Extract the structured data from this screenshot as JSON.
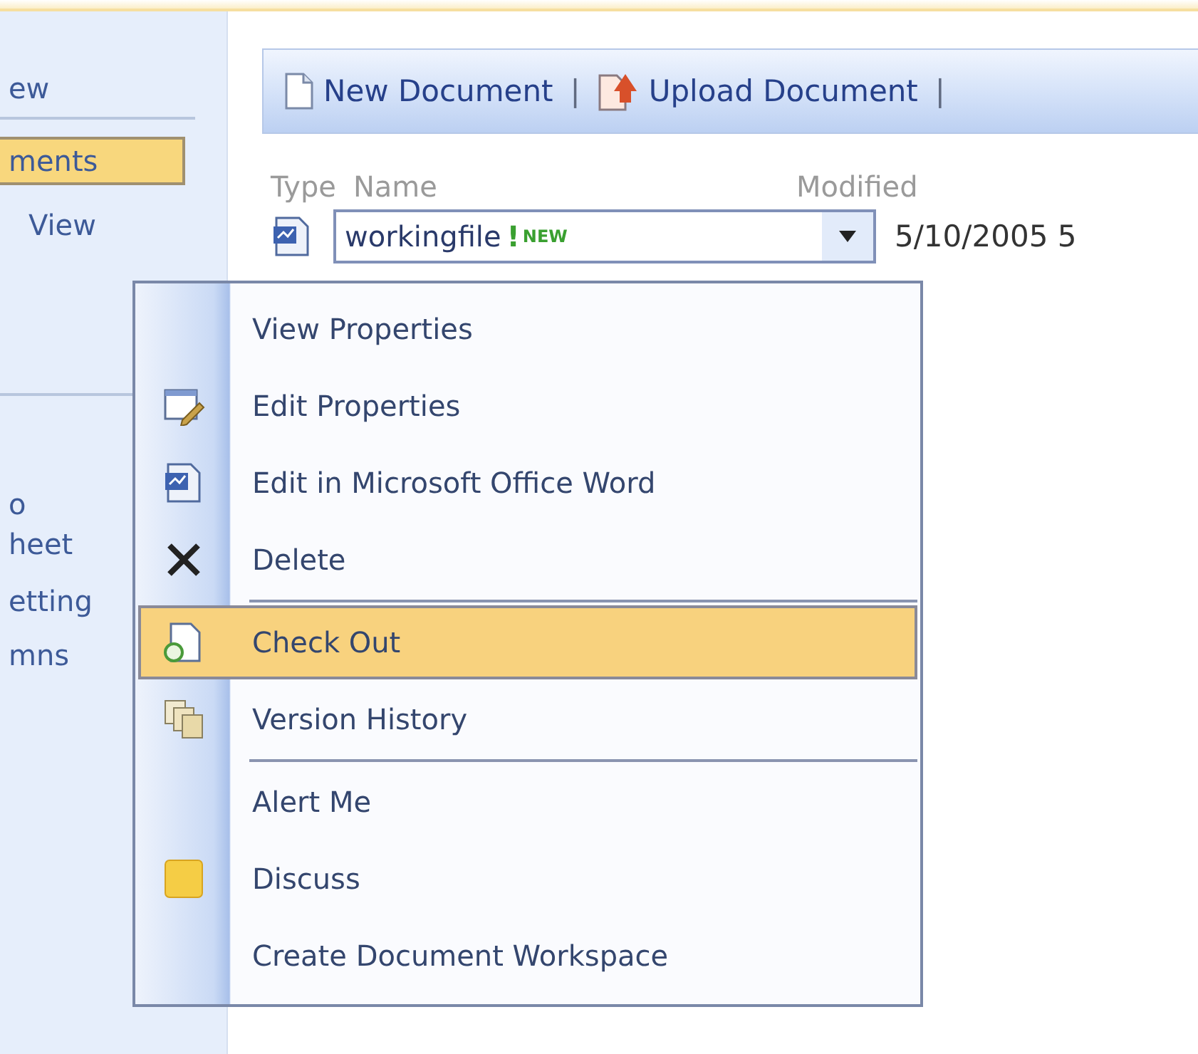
{
  "sidebar": {
    "items": [
      {
        "label": "ew",
        "selected": false
      },
      {
        "label": "ments",
        "selected": true
      },
      {
        "label": "View",
        "selected": false
      },
      {
        "label": "o",
        "selected": false
      },
      {
        "label": "heet",
        "selected": false
      },
      {
        "label": "etting",
        "selected": false
      },
      {
        "label": "mns",
        "selected": false
      }
    ]
  },
  "toolbar": {
    "items": [
      {
        "kind": "new",
        "label": "New Document"
      },
      {
        "kind": "divider",
        "label": "|"
      },
      {
        "kind": "upload",
        "label": "Upload Document"
      },
      {
        "kind": "divider",
        "label": "|"
      }
    ]
  },
  "list": {
    "columns": [
      "Type",
      "Name",
      "Modified"
    ],
    "rows": [
      {
        "name": "workingfile",
        "new_marker": "!",
        "new_badge": "NEW",
        "modified": "5/10/2005 5"
      }
    ]
  },
  "context_menu": {
    "items": [
      {
        "kind": "plain",
        "label": "View Properties",
        "selected": false,
        "separator_before": false
      },
      {
        "kind": "edit",
        "label": "Edit Properties",
        "selected": false,
        "separator_before": false
      },
      {
        "kind": "word",
        "label": "Edit in Microsoft Office Word",
        "selected": false,
        "separator_before": false
      },
      {
        "kind": "delete",
        "label": "Delete",
        "selected": false,
        "separator_before": false
      },
      {
        "kind": "checkout",
        "label": "Check Out",
        "selected": true,
        "separator_before": true
      },
      {
        "kind": "history",
        "label": "Version History",
        "selected": false,
        "separator_before": false
      },
      {
        "kind": "plain",
        "label": "Alert Me",
        "selected": false,
        "separator_before": true
      },
      {
        "kind": "discuss",
        "label": "Discuss",
        "selected": false,
        "separator_before": false
      },
      {
        "kind": "plain",
        "label": "Create Document Workspace",
        "selected": false,
        "separator_before": false
      }
    ]
  }
}
